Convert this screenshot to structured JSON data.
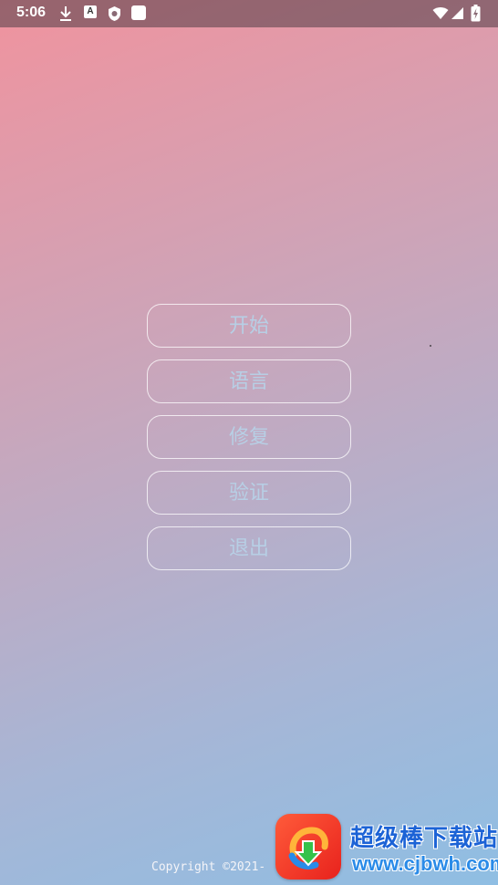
{
  "status_bar": {
    "time": "5:06",
    "left_icons": [
      "download-icon",
      "font-a-icon",
      "shield-icon",
      "square-app-icon"
    ],
    "right_icons": [
      "wifi-icon",
      "signal-icon",
      "battery-charging-icon"
    ]
  },
  "menu": {
    "items": [
      {
        "label": "开始"
      },
      {
        "label": "语言"
      },
      {
        "label": "修复"
      },
      {
        "label": "验证"
      },
      {
        "label": "退出"
      }
    ]
  },
  "footer": {
    "copyright": "Copyright ©2021-"
  },
  "watermark": {
    "title": "超级棒下载站",
    "url": "www.cjbwh.com"
  },
  "colors": {
    "gradient_top": "#f0939e",
    "gradient_bottom": "#8fbee3",
    "button_text": "#b7cfe5",
    "button_border": "#ffffff",
    "watermark_title": "#1c63d6",
    "watermark_logo": "#e8221d"
  }
}
